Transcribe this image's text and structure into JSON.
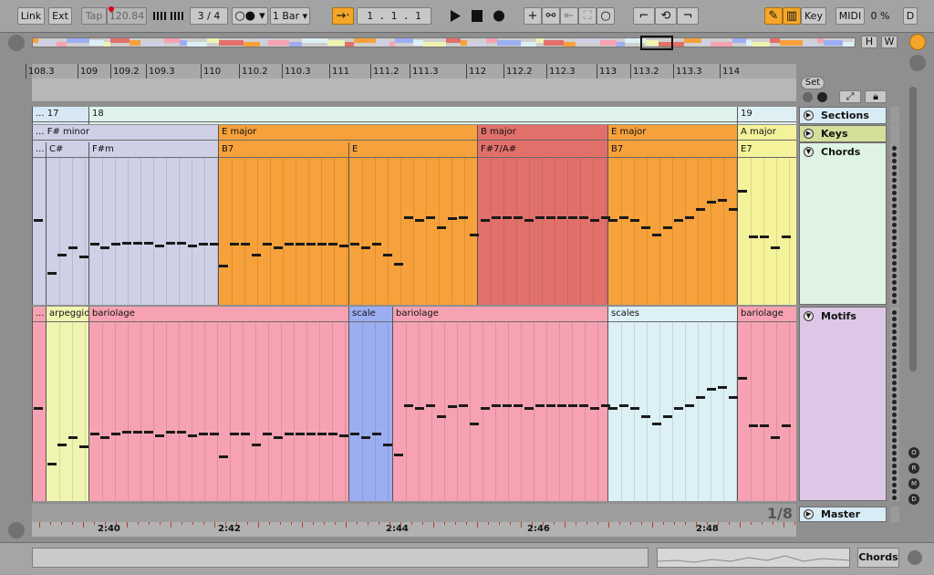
{
  "control_bar": {
    "link_label": "Link",
    "ext_label": "Ext",
    "tap_label": "Tap",
    "tempo": "120.84",
    "metronome_icon": "metronome-icon",
    "time_signature": "3 / 4",
    "follow_icon": "follow-icon",
    "quantize": "1 Bar",
    "position": "1 .  1 .  1",
    "play_icon": "play-icon",
    "stop_icon": "stop-icon",
    "record_icon": "record-icon",
    "key_label": "Key",
    "midi_label": "MIDI",
    "cpu": "0 %",
    "d_label": "D"
  },
  "overview": {
    "h_label": "H",
    "w_label": "W"
  },
  "ruler": {
    "bars": [
      "108.3",
      "109",
      "109.2",
      "109.3",
      "110",
      "110.2",
      "110.3",
      "111",
      "111.2",
      "111.3",
      "112",
      "112.2",
      "112.3",
      "113",
      "113.2",
      "113.3",
      "114"
    ],
    "set_label": "Set"
  },
  "lanes": {
    "sections": {
      "name": "Sections",
      "segments": [
        {
          "label": "... 17",
          "color": "#d7e7f3"
        },
        {
          "label": "18",
          "color": "#dff3ea"
        },
        {
          "label": "19",
          "color": "#dff0f5"
        }
      ]
    },
    "keys": {
      "name": "Keys",
      "segments": [
        {
          "label": "... F# minor",
          "color": "#cfcfe6"
        },
        {
          "label": "E major",
          "color": "#f6a13b"
        },
        {
          "label": "B major",
          "color": "#e2706a"
        },
        {
          "label": "E major",
          "color": "#f6a13b"
        },
        {
          "label": "A major",
          "color": "#f4f29a"
        }
      ]
    },
    "chords": {
      "name": "Chords",
      "segments": [
        {
          "label": "...",
          "color": "#cfcfe6"
        },
        {
          "label": "C#",
          "color": "#cfcfe6"
        },
        {
          "label": "F#m",
          "color": "#cfcfe6"
        },
        {
          "label": "B7",
          "color": "#f6a13b"
        },
        {
          "label": "E",
          "color": "#f6a13b"
        },
        {
          "label": "F#7/A#",
          "color": "#e2706a"
        },
        {
          "label": "B7",
          "color": "#f6a13b"
        },
        {
          "label": "E7",
          "color": "#f4f29a"
        }
      ]
    },
    "motifs": {
      "name": "Motifs",
      "segments": [
        {
          "label": "...",
          "color": "#f6a2b2"
        },
        {
          "label": "arpeggio",
          "color": "#eff5b0"
        },
        {
          "label": "bariolage",
          "color": "#f6a2b2"
        },
        {
          "label": "scale",
          "color": "#9caef2"
        },
        {
          "label": "bariolage",
          "color": "#f6a2b2"
        },
        {
          "label": "scales",
          "color": "#dcf0f6"
        },
        {
          "label": "bariolage",
          "color": "#f6a2b2"
        }
      ]
    },
    "master": {
      "name": "Master",
      "counter": "1/8"
    }
  },
  "time_labels": [
    "2:40",
    "2:42",
    "2:44",
    "2:46",
    "2:48"
  ],
  "side_buttons": [
    "O",
    "R",
    "M",
    "D"
  ],
  "bottom": {
    "view_label": "Chords"
  }
}
